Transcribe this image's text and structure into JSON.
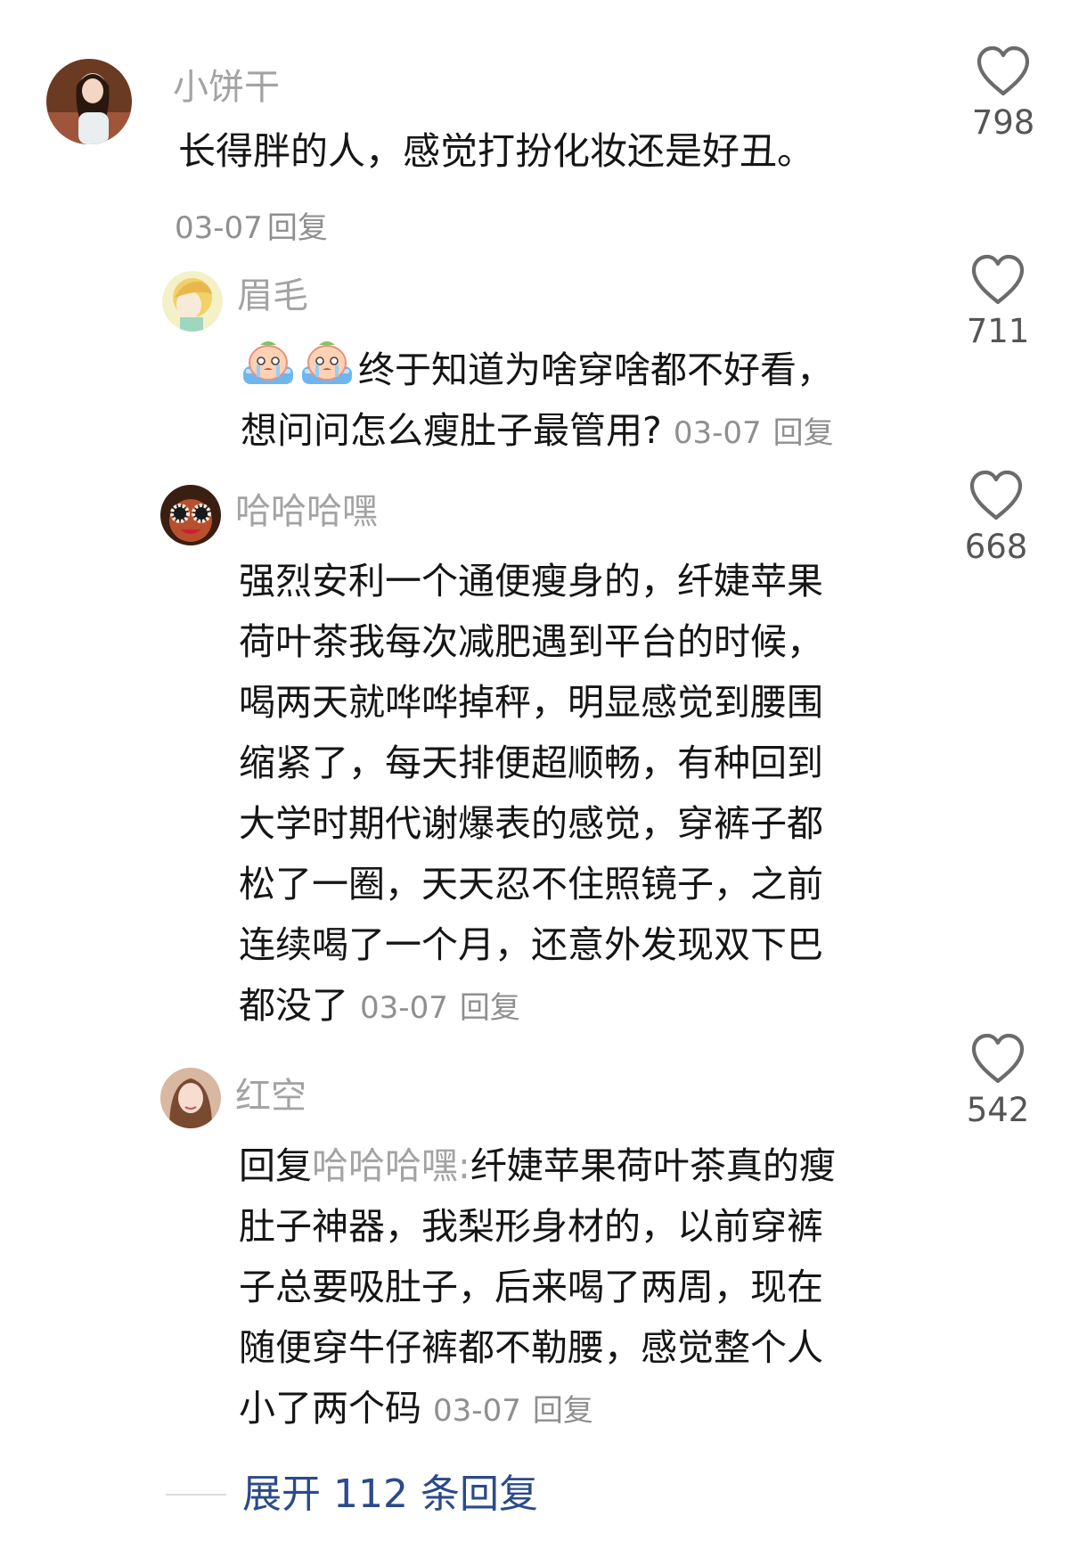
{
  "comments": [
    {
      "username": "小饼干",
      "lines": [
        "长得胖的人，感觉打扮化妆还是好丑。"
      ],
      "date": "03-07",
      "reply_label": "回复",
      "likes": "798"
    },
    {
      "username": "眉毛",
      "lines": [
        "终于知道为啥穿啥都不好看，",
        "想问问怎么瘦肚子最管用?"
      ],
      "date": "03-07",
      "reply_label": "回复",
      "likes": "711",
      "emoji": [
        "crying-emoji",
        "crying-emoji"
      ]
    },
    {
      "username": "哈哈哈嘿",
      "lines": [
        "强烈安利一个通便瘦身的，纤婕苹果",
        "荷叶茶我每次减肥遇到平台的时候，",
        "喝两天就哗哗掉秤，明显感觉到腰围",
        "缩紧了，每天排便超顺畅，有种回到",
        "大学时期代谢爆表的感觉，穿裤子都",
        "松了一圈，天天忍不住照镜子，之前",
        "连续喝了一个月，还意外发现双下巴",
        "都没了"
      ],
      "date": "03-07",
      "reply_label": "回复",
      "likes": "668"
    },
    {
      "username": "红空",
      "reply_prefix": "回复",
      "reply_to": "哈哈哈嘿:",
      "lines": [
        "纤婕苹果荷叶茶真的瘦",
        "肚子神器，我梨形身材的，以前穿裤",
        "子总要吸肚子，后来喝了两周，现在",
        "随便穿牛仔裤都不勒腰，感觉整个人",
        "小了两个码"
      ],
      "date": "03-07",
      "reply_label": "回复",
      "likes": "542"
    }
  ],
  "expand_replies": "展开 112 条回复",
  "icons": {
    "like": "heart-outline-icon"
  },
  "colors": {
    "username": "#a3a3a3",
    "text": "#151515",
    "meta": "#8f8f8f",
    "link": "#2a4a8a"
  }
}
